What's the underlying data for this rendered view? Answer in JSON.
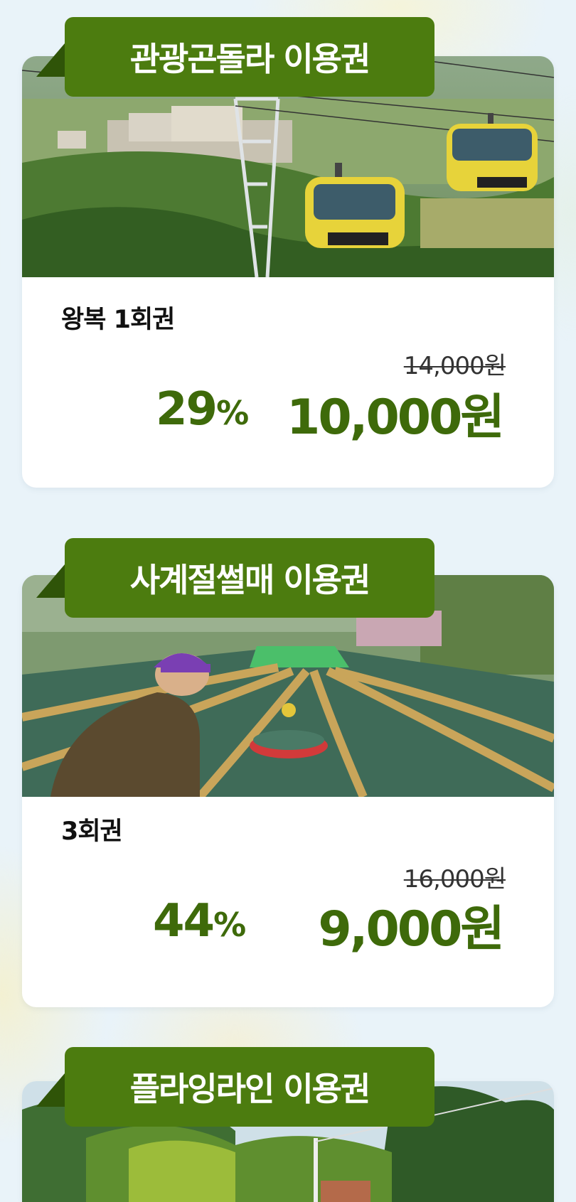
{
  "tickets": [
    {
      "title": "관광곤돌라 이용권",
      "option": "왕복 1회권",
      "original_price": "14,000원",
      "discount": "29",
      "discount_unit": "%",
      "price": "10,000원"
    },
    {
      "title": "사계절썰매 이용권",
      "option": "3회권",
      "original_price": "16,000원",
      "discount": "44",
      "discount_unit": "%",
      "price": "9,000원"
    },
    {
      "title": "플라잉라인 이용권"
    }
  ],
  "colors": {
    "banner": "#4c7c0f",
    "banner_fold": "#2f5408",
    "price_green": "#3e6a0a",
    "background": "#e9f3f9"
  }
}
